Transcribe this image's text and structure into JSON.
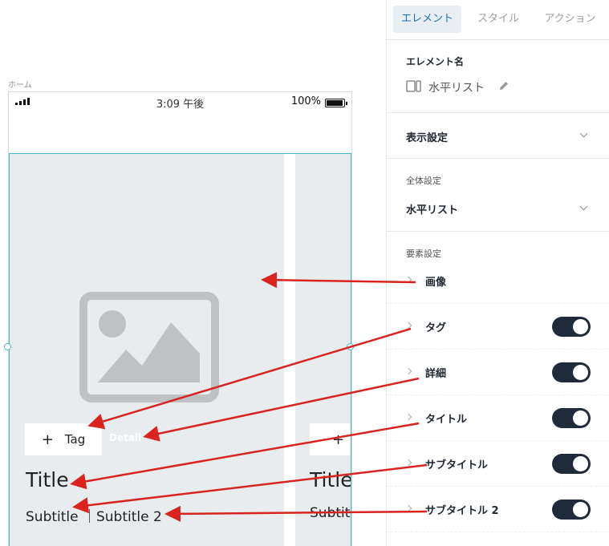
{
  "canvas": {
    "screen_label": "ホーム",
    "status": {
      "time": "3:09 午後",
      "battery": "100%"
    },
    "cards": [
      {
        "tag": "Tag",
        "detail": "Detail",
        "title": "Title",
        "subtitle": "Subtitle ｜Subtitle 2"
      },
      {
        "tag": "",
        "detail": "",
        "title": "Title",
        "subtitle": "Subtit"
      }
    ]
  },
  "panel": {
    "tabs": [
      {
        "label": "エレメント",
        "active": true
      },
      {
        "label": "スタイル",
        "active": false
      },
      {
        "label": "アクション",
        "active": false
      }
    ],
    "element_name": {
      "label": "エレメント名",
      "value": "水平リスト"
    },
    "display_settings": {
      "title": "表示設定"
    },
    "global_settings": {
      "label": "全体設定",
      "value": "水平リスト"
    },
    "element_settings": {
      "label": "要素設定",
      "items": [
        {
          "label": "画像",
          "toggle": null
        },
        {
          "label": "タグ",
          "toggle": true
        },
        {
          "label": "詳細",
          "toggle": true
        },
        {
          "label": "タイトル",
          "toggle": true
        },
        {
          "label": "サブタイトル",
          "toggle": true
        },
        {
          "label": "サブタイトル 2",
          "toggle": true
        }
      ]
    }
  },
  "colors": {
    "accent": "#1a73c8",
    "toggle_on": "#1f2a3a",
    "selection": "#43b7c6",
    "annotation_arrow": "#d9231f",
    "card_bg": "#e8ecef"
  }
}
